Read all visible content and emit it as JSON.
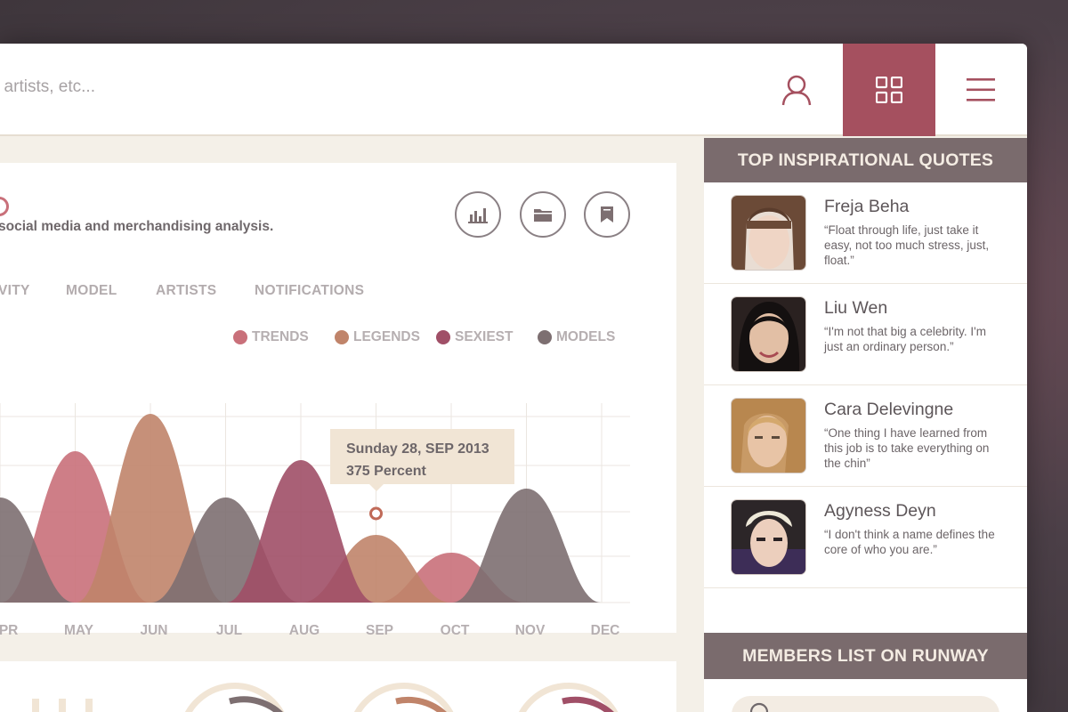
{
  "search": {
    "placeholder": ", artists, etc..."
  },
  "header_icons": [
    "user-icon",
    "grid-icon",
    "menu-icon"
  ],
  "colors": {
    "accent": "#a5505f",
    "sidebar_header": "#7a6b6d",
    "trends": "#c9707a",
    "legends": "#c0846a",
    "sexiest": "#a04f67",
    "models": "#7d6f71"
  },
  "card": {
    "subtitle": "social media and merchandising analysis.",
    "action_icons": [
      "bar-chart-icon",
      "folder-icon",
      "bookmark-icon"
    ],
    "tabs": [
      "VITY",
      "MODEL",
      "ARTISTS",
      "NOTIFICATIONS"
    ],
    "legend": [
      "TRENDS",
      "LEGENDS",
      "SEXIEST",
      "MODELS"
    ],
    "tooltip": {
      "date": "Sunday 28, SEP 2013",
      "value": "375 Percent"
    }
  },
  "chart_data": {
    "type": "area",
    "x": [
      "APR",
      "MAY",
      "JUN",
      "JUL",
      "AUG",
      "SEP",
      "OCT",
      "NOV",
      "DEC"
    ],
    "series": [
      {
        "name": "TRENDS",
        "peaks": [
          {
            "x": "MAY",
            "y": 170
          },
          {
            "x": "OCT",
            "y": 56
          }
        ]
      },
      {
        "name": "LEGENDS",
        "peaks": [
          {
            "x": "JUN",
            "y": 212
          },
          {
            "x": "SEP",
            "y": 76
          }
        ]
      },
      {
        "name": "SEXIEST",
        "peaks": [
          {
            "x": "AUG",
            "y": 160
          }
        ]
      },
      {
        "name": "MODELS",
        "peaks": [
          {
            "x": "APR",
            "y": 118
          },
          {
            "x": "JUL",
            "y": 118
          },
          {
            "x": "NOV",
            "y": 128
          }
        ]
      }
    ],
    "highlight": {
      "x": "SEP",
      "label": "375 Percent"
    },
    "grid": true
  },
  "sidebar": {
    "quotes_title": "TOP INSPIRATIONAL QUOTES",
    "quotes": [
      {
        "name": "Freja Beha",
        "text": "“Float through life, just take it easy, not too much stress, just, float.”"
      },
      {
        "name": "Liu Wen",
        "text": "“I'm not that big a celebrity. I'm just an ordinary person.”"
      },
      {
        "name": "Cara Delevingne",
        "text": "“One thing I have learned from this job is to take everything on the chin”"
      },
      {
        "name": "Agyness Deyn",
        "text": "“I don't think a name defines the core of who you are.”"
      }
    ],
    "members_title": "MEMBERS LIST ON RUNWAY"
  }
}
